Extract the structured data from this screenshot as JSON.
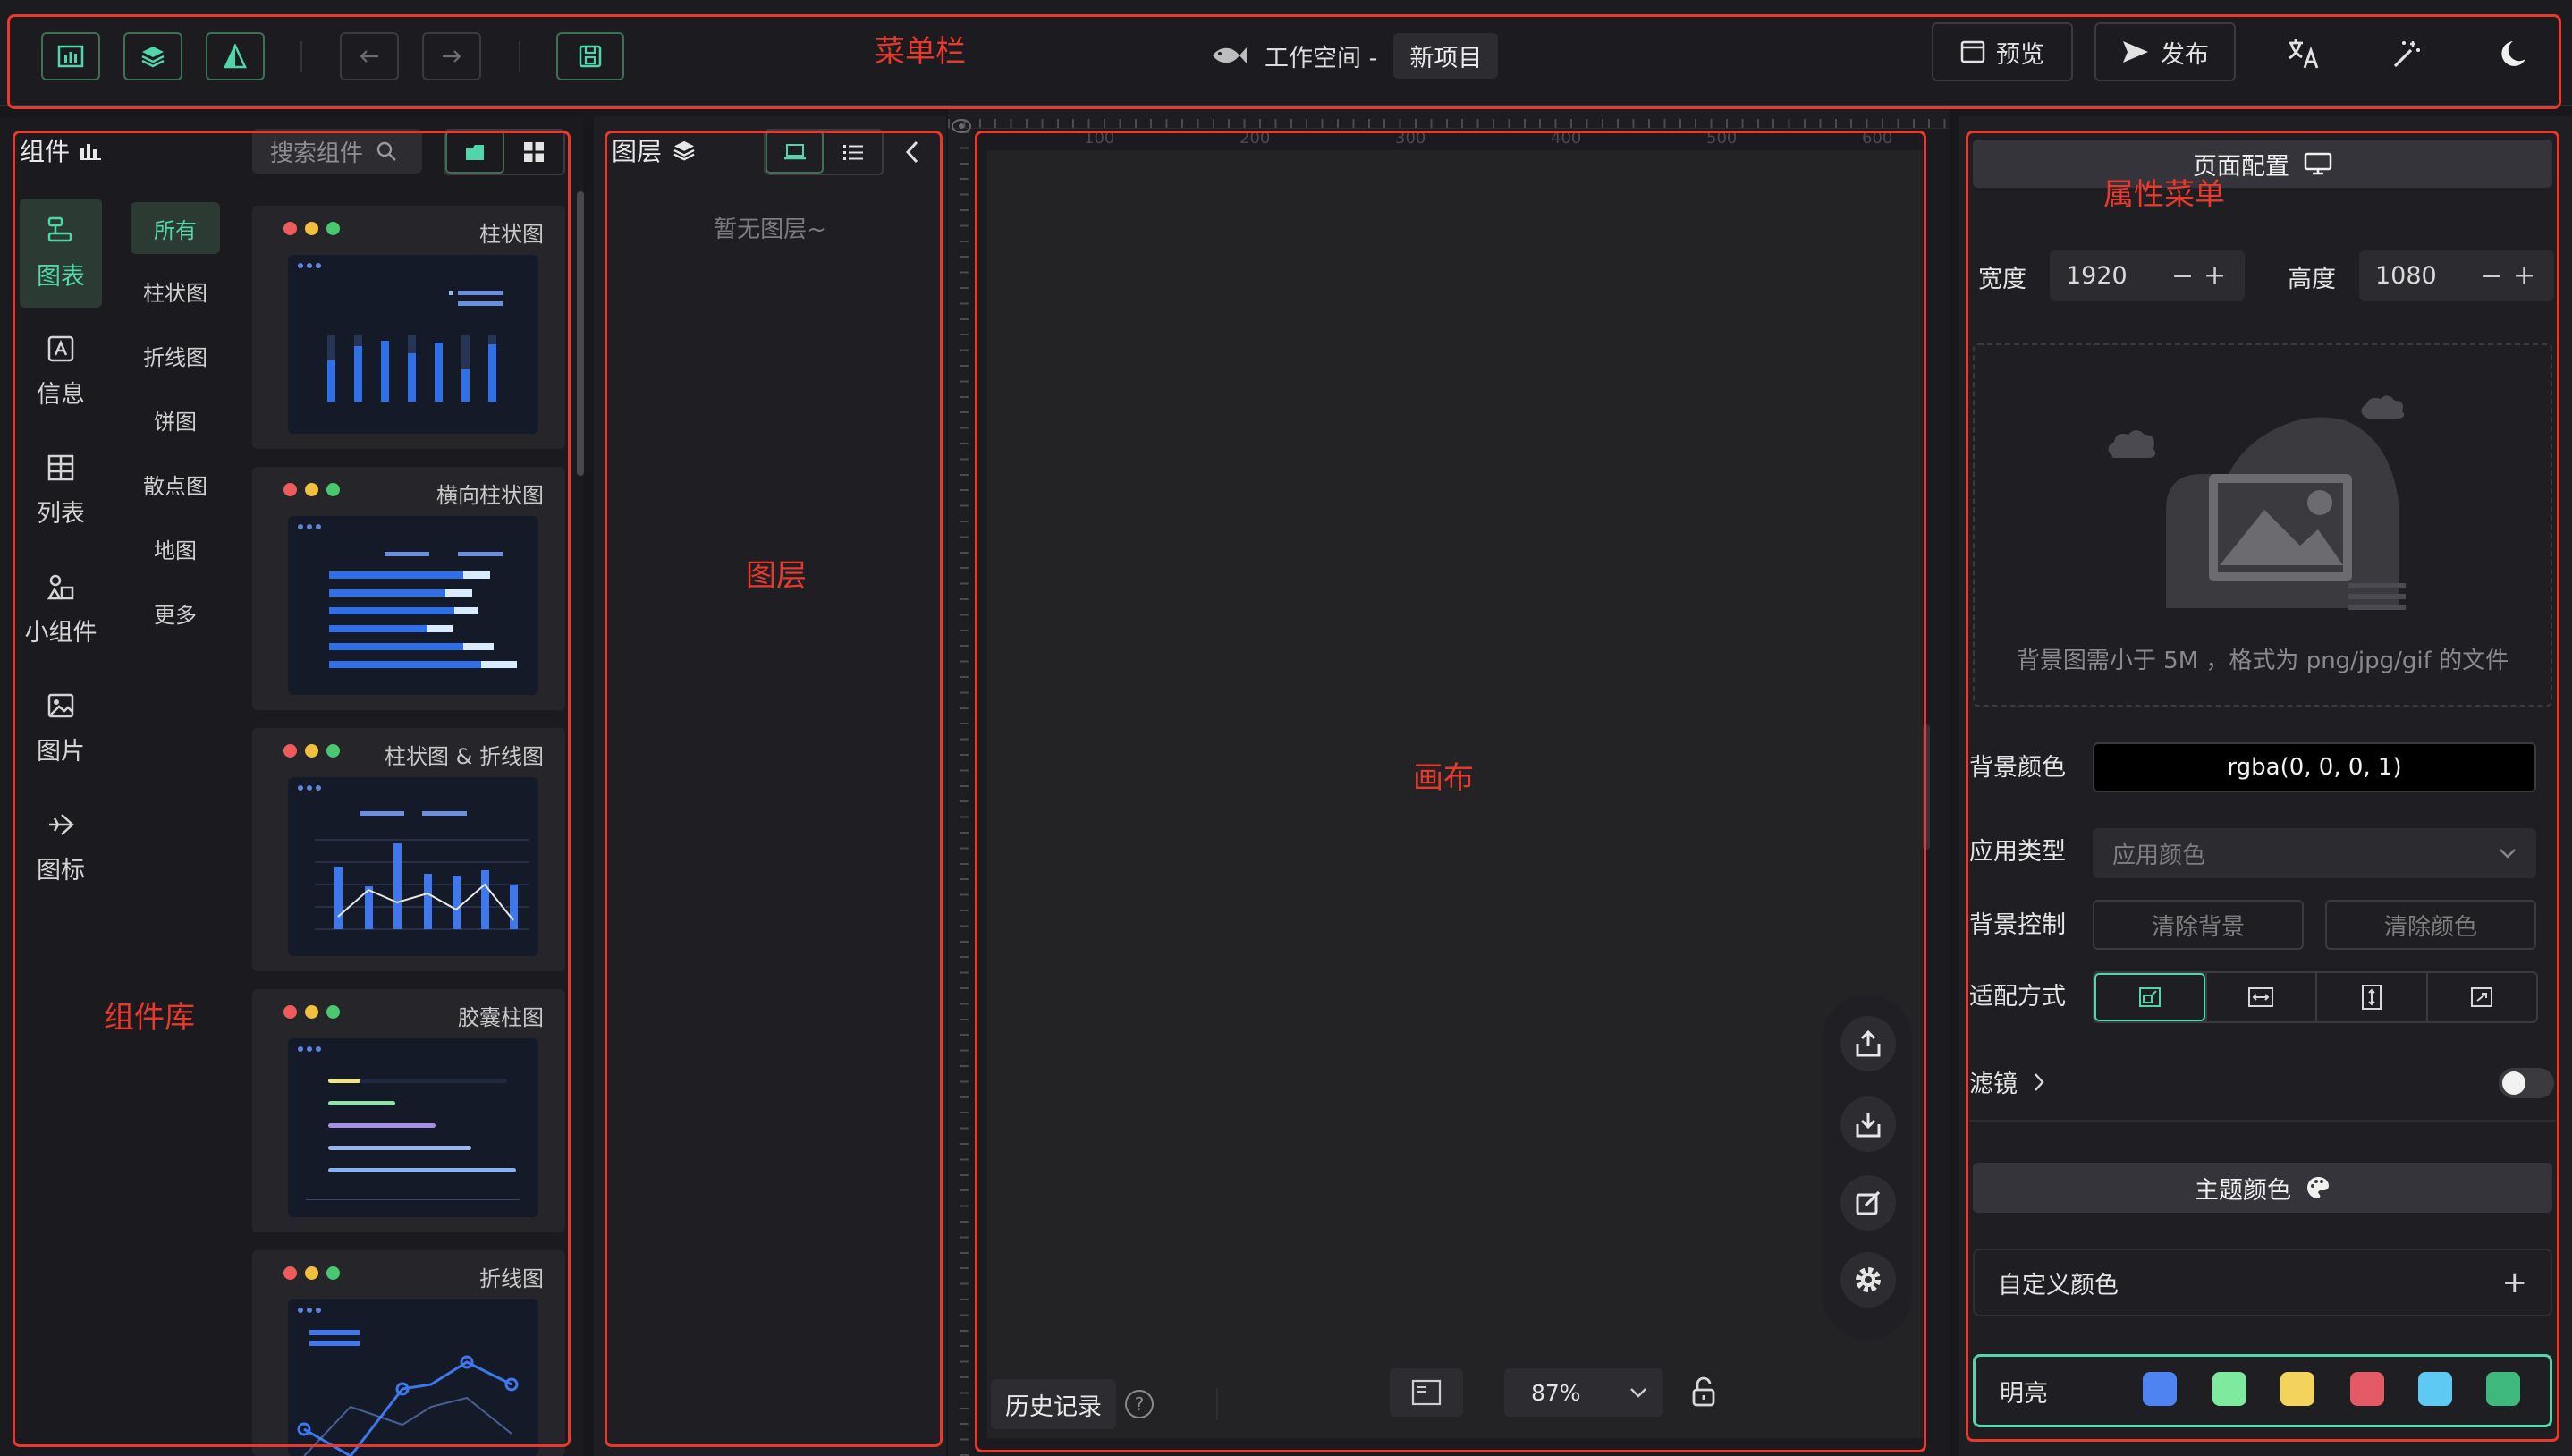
{
  "annotations": {
    "menubar": "菜单栏",
    "properties": "属性菜单",
    "layers": "图层",
    "canvas": "画布",
    "library": "组件库"
  },
  "header": {
    "workspace_label": "工作空间 -",
    "project_name": "新项目",
    "preview_label": "预览",
    "publish_label": "发布"
  },
  "components": {
    "title": "组件",
    "search_placeholder": "搜索组件",
    "sidebar": [
      {
        "label": "图表",
        "icon": "chart-icon"
      },
      {
        "label": "信息",
        "icon": "info-icon"
      },
      {
        "label": "列表",
        "icon": "table-icon"
      },
      {
        "label": "小组件",
        "icon": "widget-icon"
      },
      {
        "label": "图片",
        "icon": "image-icon"
      },
      {
        "label": "图标",
        "icon": "plane-icon"
      }
    ],
    "categories": [
      "所有",
      "柱状图",
      "折线图",
      "饼图",
      "散点图",
      "地图",
      "更多"
    ],
    "cards": [
      "柱状图",
      "横向柱状图",
      "柱状图 & 折线图",
      "胶囊柱图",
      "折线图"
    ]
  },
  "layers": {
    "title": "图层",
    "empty_text": "暂无图层~"
  },
  "canvas": {
    "ruler_ticks": [
      "100",
      "200",
      "300",
      "400",
      "500",
      "600"
    ],
    "history_label": "历史记录",
    "zoom": "87%"
  },
  "properties": {
    "page_config_title": "页面配置",
    "width_label": "宽度",
    "width_value": "1920",
    "height_label": "高度",
    "height_value": "1080",
    "upload_hint": "背景图需小于 5M ，格式为 png/jpg/gif 的文件",
    "bg_color_label": "背景颜色",
    "bg_color_value": "rgba(0, 0, 0, 1)",
    "apply_type_label": "应用类型",
    "apply_type_value": "应用颜色",
    "bg_control_label": "背景控制",
    "clear_bg_label": "清除背景",
    "clear_color_label": "清除颜色",
    "fit_mode_label": "适配方式",
    "filter_label": "滤镜",
    "theme_title": "主题颜色",
    "custom_color_label": "自定义颜色",
    "theme_name": "明亮",
    "theme_colors": [
      "#4f83f1",
      "#7dea9d",
      "#f3d35c",
      "#e35a66",
      "#5ec9f2",
      "#3fb87e"
    ]
  },
  "colors": {
    "accent_green": "#51d6a9",
    "annotation_red": "#e8392c"
  }
}
